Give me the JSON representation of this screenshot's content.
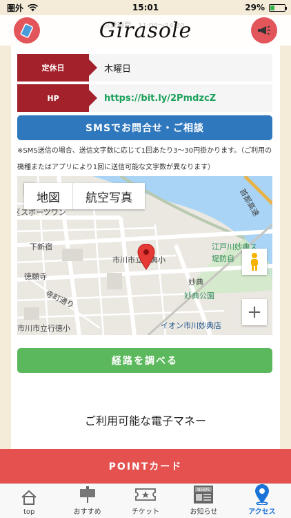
{
  "status_bar": {
    "carrier": "圏外",
    "time": "15:01",
    "battery": "29%",
    "battery_level": 0.29
  },
  "header": {
    "logo": "Girasole",
    "behind_text_1": "営業時間",
    "behind_text_2": "11:00～14:30"
  },
  "info_rows": [
    {
      "label": "定休日",
      "value": "木曜日"
    },
    {
      "label": "HP",
      "value": "https://bit.ly/2PmdzcZ"
    }
  ],
  "sms_button": "SMSでお問合せ・ご相談",
  "sms_note": "※SMS送信の場合、送信文字数に応じて1回あたり3～30円掛かります。（ご利用の機種またはアプリにより1回に送信可能な文字数が異なります）",
  "map": {
    "tabs": [
      "地図",
      "航空写真"
    ],
    "labels": {
      "shimoshinjuku": "下新宿",
      "tokuganji": "徳願寺",
      "teramachi": "寺町通り",
      "ichikawa_myoten": "市川市立妙典小",
      "edogawa_park_1": "江戸川妙典ス",
      "edogawa_park_2": "堤防自",
      "myoten": "妙典",
      "myoten_park": "妙典公園",
      "ichikawa_tokuwa": "市川市立行徳小",
      "aeon": "イオン市川妙典店",
      "expressway": "首都高速",
      "sports": "区スポーツワン"
    }
  },
  "route_button": "経路を調べる",
  "emoney_title": "ご利用可能な電子マネー",
  "point_card": "POINTカード",
  "tabs": [
    {
      "label": "top",
      "icon": "home-icon"
    },
    {
      "label": "おすすめ",
      "icon": "signboard-icon"
    },
    {
      "label": "チケット",
      "icon": "ticket-icon"
    },
    {
      "label": "お知らせ",
      "icon": "news-icon"
    },
    {
      "label": "アクセス",
      "icon": "location-pin-icon"
    }
  ],
  "colors": {
    "label_red": "#a3212b",
    "sms_blue": "#2f78be",
    "route_green": "#5cb85c",
    "point_red": "#e4514f",
    "active_tab": "#1a73d6",
    "link_green": "#1aa05b"
  }
}
